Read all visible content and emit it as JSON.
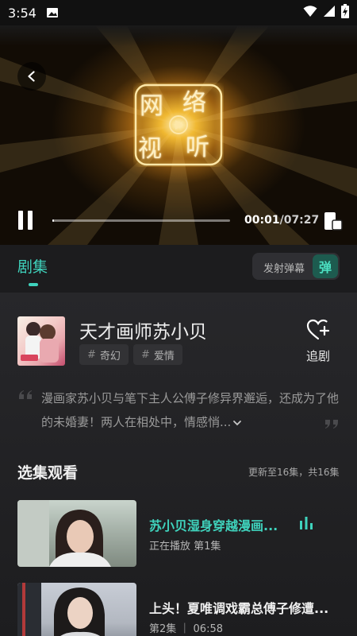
{
  "status_bar": {
    "time": "3:54"
  },
  "player": {
    "logo_chars": [
      "网",
      "络",
      "视",
      "听"
    ],
    "current_time": "00:01",
    "separator": "/",
    "duration": "07:27",
    "progress_fraction": 0.002
  },
  "tabs": {
    "episodes_label": "剧集"
  },
  "danmaku": {
    "input_placeholder": "发射弹幕",
    "toggle_label": "弹"
  },
  "show": {
    "title": "天才画师苏小贝",
    "tags": [
      "奇幻",
      "爱情"
    ],
    "tag_symbol": "#",
    "follow_label": "追剧",
    "synopsis": "漫画家苏小贝与笔下主人公傅子修异界邂逅，还成为了他的未婚妻！两人在相处中，情感悄..."
  },
  "episodes_section": {
    "title": "选集观看",
    "update_info": "更新至16集，共16集",
    "items": [
      {
        "title": "苏小贝湿身穿越漫画...",
        "subtitle": "正在播放 第1集"
      },
      {
        "title": "上头！夏唯调戏霸总傅子修遭...",
        "subtitle": "第2集 ｜ 06:58"
      }
    ]
  },
  "colors": {
    "accent": "#3fd3bd",
    "background": "#1c1c1e",
    "danmaku_toggle_bg": "#1d5b4f"
  }
}
